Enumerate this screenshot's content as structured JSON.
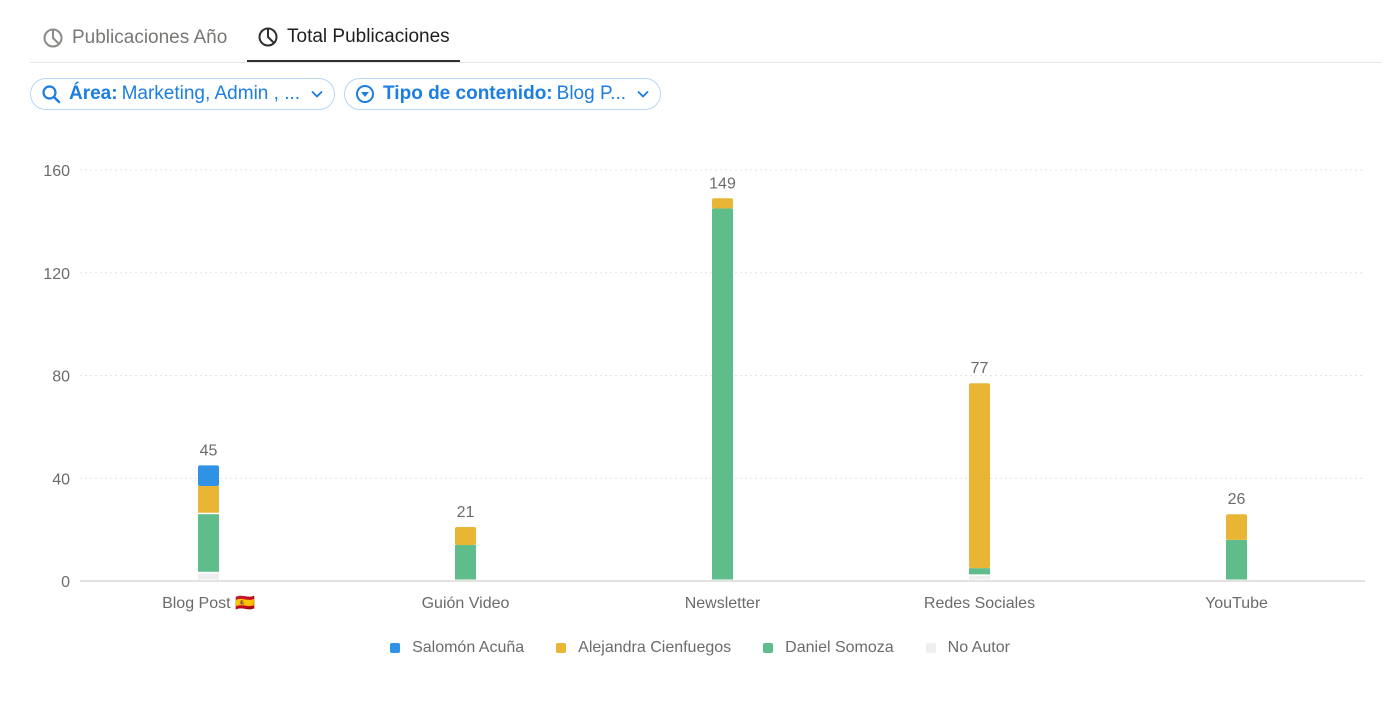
{
  "tabs": [
    {
      "label": "Publicaciones Año",
      "active": false
    },
    {
      "label": "Total Publicaciones",
      "active": true
    }
  ],
  "filters": [
    {
      "key": "Área:",
      "value": "Marketing, Admin , ...",
      "icon": "search-icon"
    },
    {
      "key": "Tipo de contenido:",
      "value": "Blog P...",
      "icon": "filter-icon"
    }
  ],
  "chart_data": {
    "type": "bar",
    "stacked": true,
    "categories": [
      "Blog Post 🇪🇸",
      "Guión Video",
      "Newsletter",
      "Redes Sociales",
      "YouTube"
    ],
    "series": [
      {
        "name": "No Autor",
        "color": "#efefef",
        "values": [
          3,
          0,
          0,
          2,
          0
        ]
      },
      {
        "name": "Daniel Somoza",
        "color": "#5fbd8b",
        "values": [
          23,
          14,
          145,
          3,
          16
        ]
      },
      {
        "name": "Alejandra Cienfuegos",
        "color": "#e8b535",
        "values": [
          11,
          7,
          4,
          72,
          10
        ]
      },
      {
        "name": "Salomón Acuña",
        "color": "#2f92e4",
        "values": [
          8,
          0,
          0,
          0,
          0
        ]
      }
    ],
    "totals": [
      45,
      21,
      149,
      77,
      26
    ],
    "legend_order": [
      "Salomón Acuña",
      "Alejandra Cienfuegos",
      "Daniel Somoza",
      "No Autor"
    ],
    "ylim": [
      0,
      160
    ],
    "yticks": [
      0,
      40,
      80,
      120,
      160
    ],
    "grid": true,
    "legend_position": "bottom-center"
  }
}
